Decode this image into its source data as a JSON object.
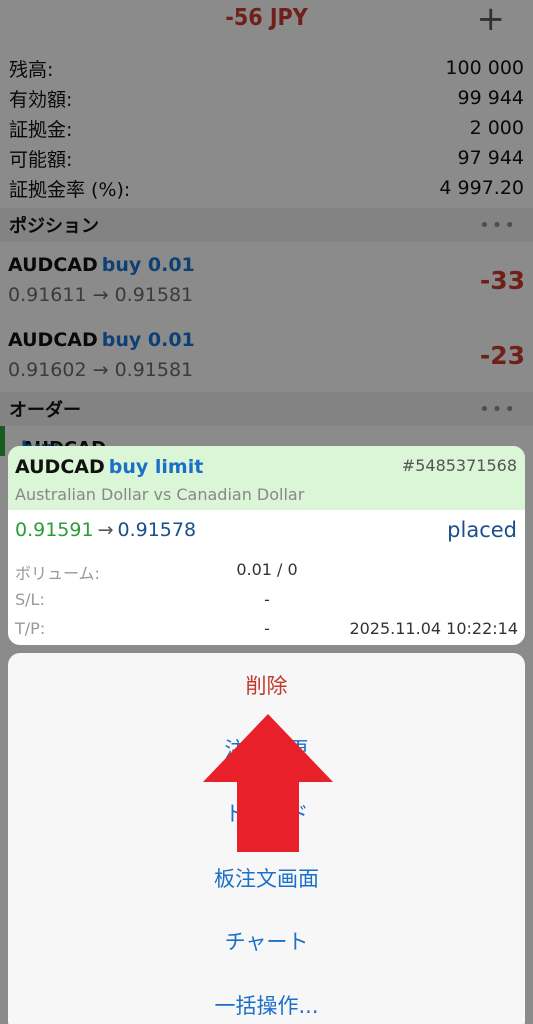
{
  "header": {
    "title": "-56 JPY",
    "add_icon": "plus-icon"
  },
  "summary": [
    {
      "label": "残高:",
      "value": "100 000"
    },
    {
      "label": "有効額:",
      "value": "99 944"
    },
    {
      "label": "証拠金:",
      "value": "2 000"
    },
    {
      "label": "可能額:",
      "value": "97 944"
    },
    {
      "label": "証拠金率 (%):",
      "value": "4 997.20"
    }
  ],
  "positions_section": {
    "label": "ポジション",
    "more": "•••"
  },
  "positions": [
    {
      "symbol": "AUDCAD",
      "side": "buy 0.01",
      "prices": "0.91611 → 0.91581",
      "pl": "-33"
    },
    {
      "symbol": "AUDCAD",
      "side": "buy 0.01",
      "prices": "0.91602 → 0.91581",
      "pl": "-23"
    }
  ],
  "orders_section": {
    "label": "オーダー",
    "more": "•••"
  },
  "order_peek": {
    "symbol": "AUDCAD",
    "side": "buy limit"
  },
  "detail": {
    "symbol": "AUDCAD",
    "side": "buy limit",
    "ticket": "#5485371568",
    "description": "Australian Dollar vs Canadian Dollar",
    "open_price": "0.91591",
    "arrow": "→",
    "current_price": "0.91578",
    "status": "placed",
    "volume_label": "ボリューム:",
    "volume_value": "0.01 / 0",
    "sl_label": "S/L:",
    "sl_value": "-",
    "tp_label": "T/P:",
    "tp_value": "-",
    "time": "2025.11.04 10:22:14"
  },
  "actions": {
    "delete": "削除",
    "modify": "注文変更",
    "trade": "トレード",
    "depth": "板注文画面",
    "chart": "チャート",
    "bulk": "一括操作..."
  },
  "colors": {
    "loss": "#c0392b",
    "link": "#1a6fc9",
    "buy_open": "#2a9d3a",
    "arrow_overlay": "#e8202a"
  }
}
